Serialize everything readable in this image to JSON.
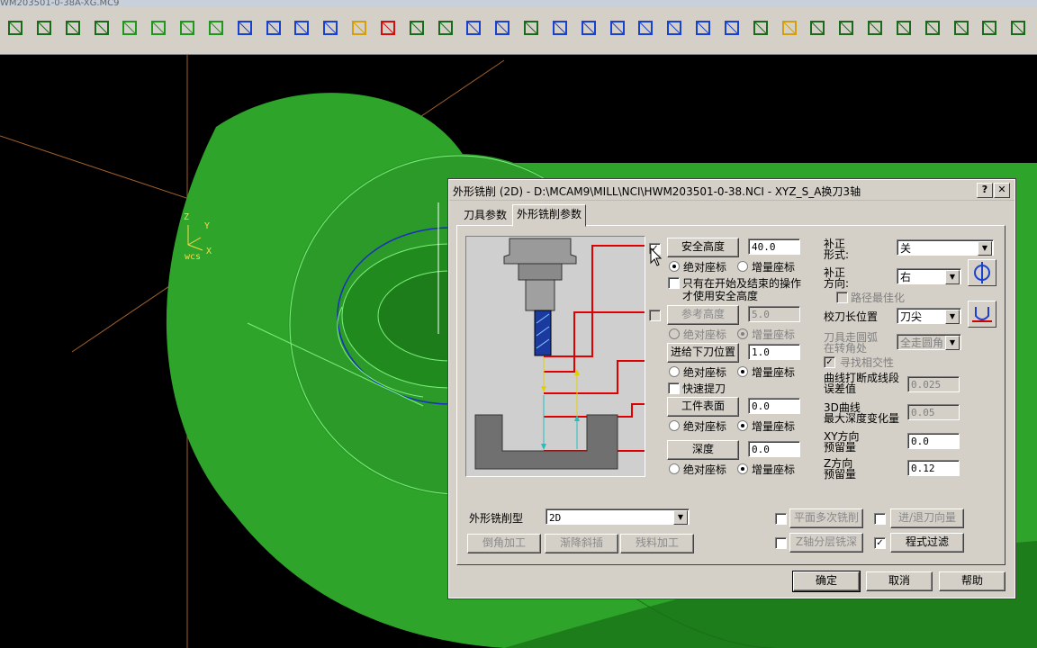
{
  "window": {
    "title_fragment": "WM203501-0-38A-XG.MC9"
  },
  "toolbar": {
    "icons": [
      "zoom-icon",
      "pan-icon",
      "zoom-window-icon",
      "unzoom-icon",
      "view-iso-cube-icon",
      "view-top-cube-icon",
      "view-front-cube-icon",
      "view-side-cube-icon",
      "view-cube-blue-icon",
      "view-cube-blue2-icon",
      "view-cube-outline-icon",
      "view-cube-outline2-icon",
      "pencil-icon",
      "no-entry-icon",
      "transform-icon",
      "transform2-icon",
      "undo-arc-icon",
      "sphere-icon",
      "layers-icon",
      "sigma-icon",
      "line-icon",
      "arc-icon",
      "curve-icon",
      "spline-icon",
      "rectangle-icon",
      "point-plus-icon",
      "plane-icon",
      "solid-box-icon",
      "level-bar-icon",
      "trim-icon",
      "break-icon",
      "join-icon",
      "split-icon",
      "extend-icon",
      "offset-icon",
      "shape-icon"
    ]
  },
  "viewport": {
    "wcs": {
      "z": "Z",
      "y": "Y",
      "x": "X",
      "label": "wcs"
    },
    "colors": {
      "solid": "#2e9e2a",
      "solid_dark": "#1f7a1c",
      "axis": "#a0602a",
      "toolpath_blue": "#1a30c0",
      "toolpath_green": "#7cf07c"
    }
  },
  "dialog": {
    "title": "外形铣削 (2D) - D:\\MCAM9\\MILL\\NCI\\HWM203501-0-38.NCI - XYZ_S_A换刀3轴",
    "help_btn": "?",
    "close_btn": "✕",
    "tabs": [
      "刀具参数",
      "外形铣削参数"
    ],
    "active_tab": 1,
    "left": {
      "safe_height": {
        "label": "安全高度",
        "value": "40.0",
        "checked": true
      },
      "safe_abs": "绝对座标",
      "safe_inc": "增量座标",
      "only_start_end_line1": "只有在开始及结束的操作",
      "only_start_end_line2": "才使用安全高度",
      "ref_height": {
        "label": "参考高度",
        "value": "5.0"
      },
      "ref_abs": "绝对座标",
      "ref_inc": "增量座标",
      "feed_plane": {
        "label": "进给下刀位置",
        "value": "1.0"
      },
      "feed_abs": "绝对座标",
      "feed_inc": "增量座标",
      "rapid_retract": "快速提刀",
      "top_stock": {
        "label": "工件表面",
        "value": "0.0"
      },
      "top_abs": "绝对座标",
      "top_inc": "增量座标",
      "depth": {
        "label": "深度",
        "value": "0.0"
      },
      "depth_abs": "绝对座标",
      "depth_inc": "增量座标"
    },
    "right": {
      "comp_type_line1": "补正",
      "comp_type_line2": "形式:",
      "comp_type_value": "关",
      "comp_dir_line1": "补正",
      "comp_dir_line2": "方向:",
      "comp_dir_value": "右",
      "path_opt": "路径最佳化",
      "tip_comp": "校刀长位置",
      "tip_comp_value": "刀尖",
      "roll_line1": "刀具走圆弧",
      "roll_line2": "在转角处",
      "roll_value": "全走圆角",
      "infinite_look": "寻找相交性",
      "linearize_line1": "曲线打断成线段",
      "linearize_line2": "误差值",
      "linearize_value": "0.025",
      "max_depth_line1": "3D曲线",
      "max_depth_line2": "最大深度变化量",
      "max_depth_value": "0.05",
      "xy_stock_line1": "XY方向",
      "xy_stock_line2": "预留量",
      "xy_stock_value": "0.0",
      "z_stock_line1": "Z方向",
      "z_stock_line2": "预留量",
      "z_stock_value": "0.12"
    },
    "bottom": {
      "contour_type_label": "外形铣削型",
      "contour_type_value": "2D",
      "chamfer": "倒角加工",
      "ramp": "渐降斜插",
      "remachine": "残料加工",
      "multi_passes": "平面多次铣削",
      "lead_in_out": "进/退刀向量",
      "depth_cuts": "Z轴分层铣深",
      "filter": "程式过滤"
    },
    "ok": "确定",
    "cancel": "取消",
    "help": "帮助"
  }
}
